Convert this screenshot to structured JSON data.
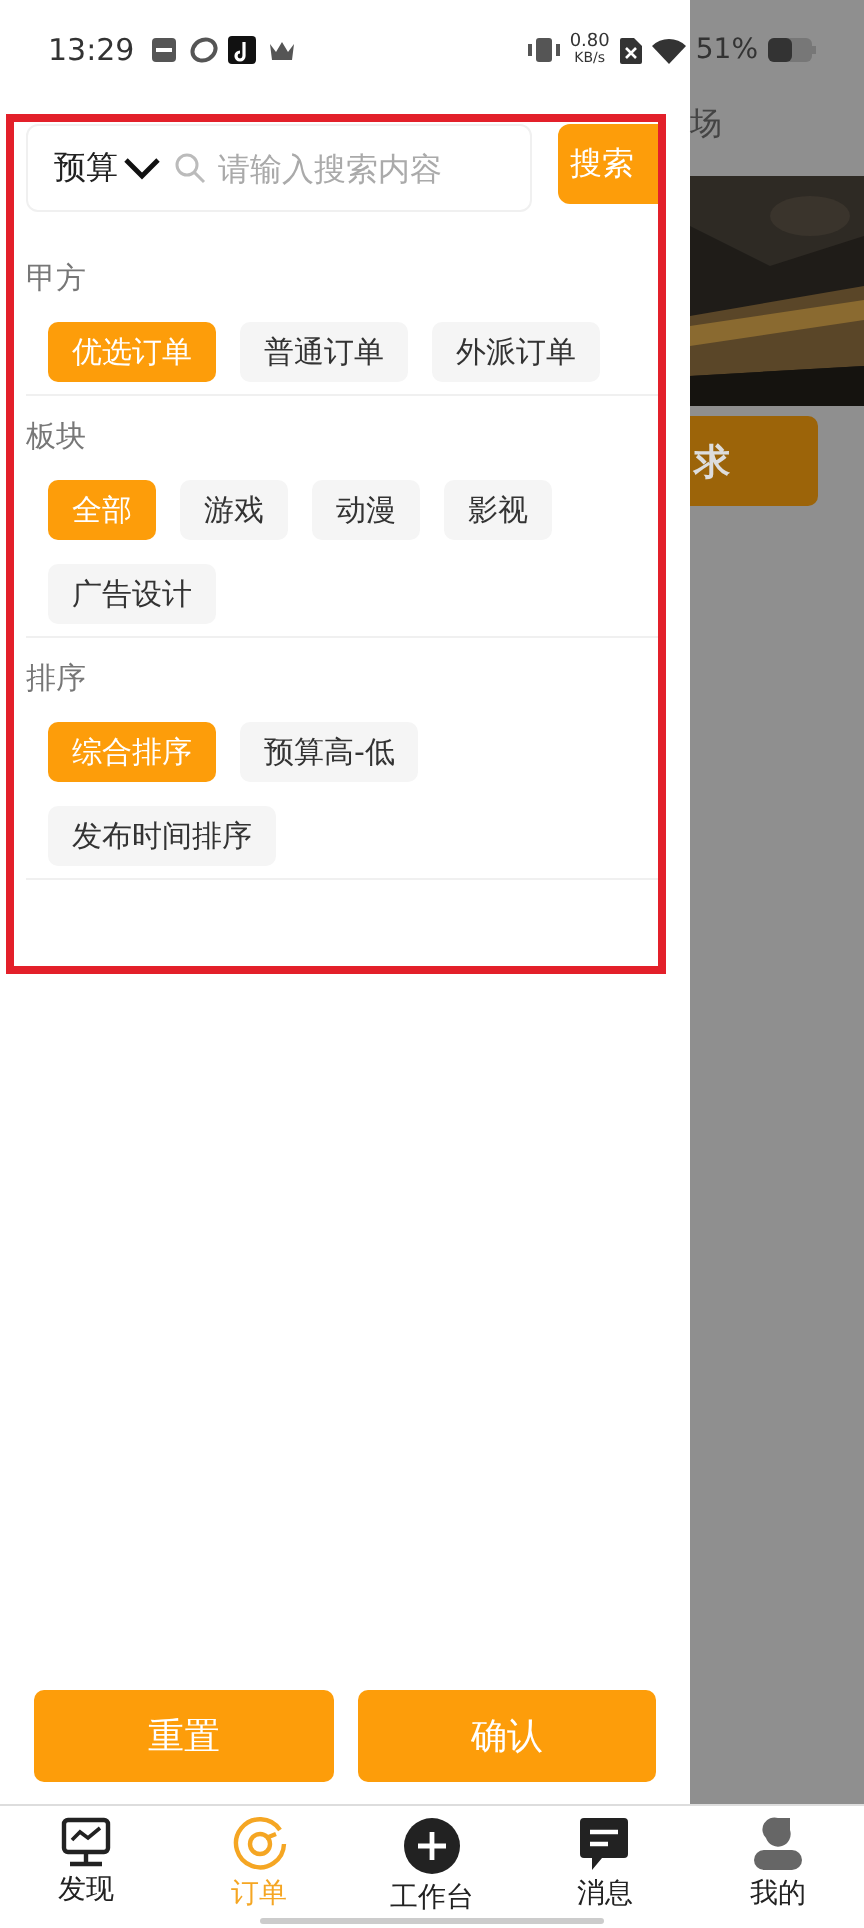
{
  "status_bar": {
    "time": "13:29",
    "net_speed": "0.80",
    "net_unit": "KB/s",
    "battery": "51%"
  },
  "search": {
    "dropdown": "预算",
    "placeholder": "请输入搜索内容",
    "button": "搜索"
  },
  "filters": [
    {
      "title": "甲方",
      "options": [
        {
          "label": "优选订单",
          "selected": true
        },
        {
          "label": "普通订单",
          "selected": false
        },
        {
          "label": "外派订单",
          "selected": false
        }
      ]
    },
    {
      "title": "板块",
      "options": [
        {
          "label": "全部",
          "selected": true
        },
        {
          "label": "游戏",
          "selected": false
        },
        {
          "label": "动漫",
          "selected": false
        },
        {
          "label": "影视",
          "selected": false
        },
        {
          "label": "广告设计",
          "selected": false
        }
      ]
    },
    {
      "title": "排序",
      "options": [
        {
          "label": "综合排序",
          "selected": true
        },
        {
          "label": "预算高-低",
          "selected": false
        },
        {
          "label": "发布时间排序",
          "selected": false
        }
      ]
    }
  ],
  "actions": [
    "重置",
    "确认"
  ],
  "background_page": {
    "heading_fragment": "场",
    "button_fragment": "求"
  },
  "tab_bar": [
    {
      "label": "发现",
      "selected": false,
      "kind": "monitor"
    },
    {
      "label": "订单",
      "selected": true,
      "kind": "target"
    },
    {
      "label": "工作台",
      "selected": false,
      "kind": "plus"
    },
    {
      "label": "消息",
      "selected": false,
      "kind": "chat"
    },
    {
      "label": "我的",
      "selected": false,
      "kind": "person"
    }
  ]
}
